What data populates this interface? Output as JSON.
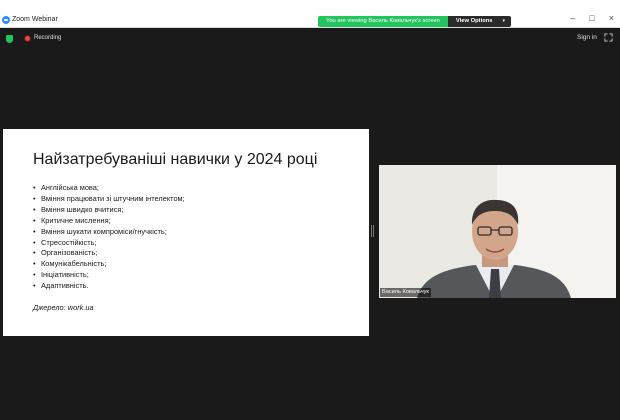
{
  "window": {
    "title": "Zoom Webinar",
    "banner_text": "You are viewing Василь Ковальчук's screen",
    "view_options_label": "View Options",
    "controls": [
      "–",
      "□",
      "×"
    ]
  },
  "toolbar": {
    "recording_label": "Recording",
    "signin_label": "Sign in"
  },
  "slide": {
    "title": "Найзатребуваніші навички у 2024 році",
    "bullets": [
      "Англійська мова;",
      "Вміння працювати зі штучним інтелектом;",
      "Вміння швидко вчитися;",
      "Критичне мислення;",
      "Вміння шукати компроміси/гнучкість;",
      "Стресостійкість;",
      "Організованість;",
      "Комунікабельність;",
      "Ініціативність;",
      "Адаптивність."
    ],
    "source": "Джерело: work.ua"
  },
  "video": {
    "participant_name": "Василь Ковальчук"
  },
  "icons": {
    "app": "zoom-logo-icon",
    "security": "shield-icon",
    "recording": "record-dot-icon",
    "fullscreen": "expand-icon"
  },
  "colors": {
    "banner_green": "#23c45e",
    "recording_red": "#e8453c",
    "zoom_blue": "#2d8cff",
    "background_dark": "#1a1a1a"
  }
}
